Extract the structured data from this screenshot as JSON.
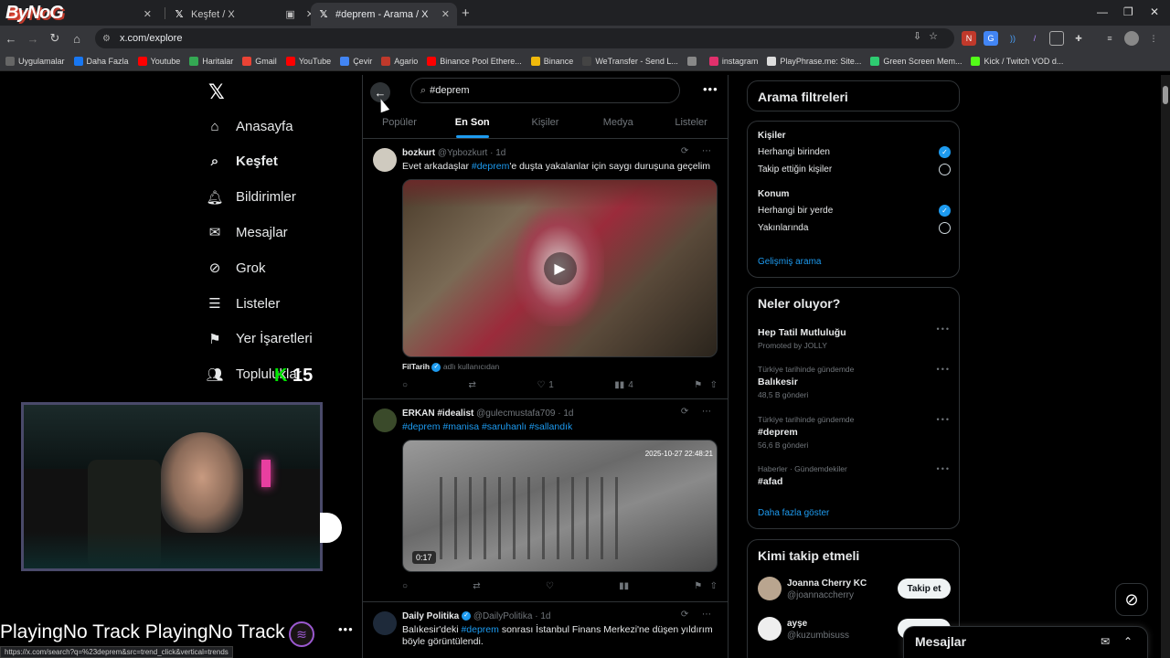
{
  "browser": {
    "tabs": [
      {
        "title": "",
        "fav": "",
        "color": "#e74c3c"
      },
      {
        "title": "Keşfet / X",
        "fav": "X",
        "color": "#000"
      },
      {
        "title": "#deprem - Arama / X",
        "fav": "X",
        "color": "#000"
      }
    ],
    "url": "x.com/explore",
    "bookmarks": [
      {
        "label": "Uygulamalar",
        "color": "#666"
      },
      {
        "label": "Daha Fazla",
        "color": "#1877f2"
      },
      {
        "label": "Youtube",
        "color": "#ff0000"
      },
      {
        "label": "Haritalar",
        "color": "#34a853"
      },
      {
        "label": "Gmail",
        "color": "#ea4335"
      },
      {
        "label": "YouTube",
        "color": "#ff0000"
      },
      {
        "label": "Çevir",
        "color": "#4285f4"
      },
      {
        "label": "Agario",
        "color": "#c0392b"
      },
      {
        "label": "Binance Pool Ethere...",
        "color": "#ff0000"
      },
      {
        "label": "Binance",
        "color": "#f0b90b"
      },
      {
        "label": "WeTransfer - Send L...",
        "color": "#444"
      },
      {
        "label": "",
        "color": "#888"
      },
      {
        "label": "instagram",
        "color": "#e1306c"
      },
      {
        "label": "PlayPhrase.me: Site...",
        "color": "#ddd"
      },
      {
        "label": "Green Screen Mem...",
        "color": "#2ecc71"
      },
      {
        "label": "Kick / Twitch VOD d...",
        "color": "#53fc18"
      }
    ],
    "status_url": "https://x.com/search?q=%23deprem&src=trend_click&vertical=trends"
  },
  "overlay": {
    "logo": "ByNoG",
    "badge_number": "15",
    "ticker": "PlayingNo Track PlayingNo Track"
  },
  "nav": {
    "items": [
      {
        "label": "Anasayfa",
        "icon": "home-icon",
        "bold": false
      },
      {
        "label": "Keşfet",
        "icon": "search-icon",
        "bold": true
      },
      {
        "label": "Bildirimler",
        "icon": "bell-icon",
        "bold": false
      },
      {
        "label": "Mesajlar",
        "icon": "envelope-icon",
        "bold": false
      },
      {
        "label": "Grok",
        "icon": "grok-icon",
        "bold": false
      },
      {
        "label": "Listeler",
        "icon": "list-icon",
        "bold": false
      },
      {
        "label": "Yer İşaretleri",
        "icon": "bookmark-icon",
        "bold": false
      },
      {
        "label": "Topluluklar",
        "icon": "communities-icon",
        "bold": false
      }
    ]
  },
  "search": {
    "query": "#deprem",
    "tabs": [
      "Popüler",
      "En Son",
      "Kişiler",
      "Medya",
      "Listeler"
    ],
    "active_tab": 1
  },
  "tweets": [
    {
      "name": "bozkurt",
      "handle": "@Ypbozkurt · 1d",
      "verified": false,
      "avatar_color": "#cfcabf",
      "text_pre": "Evet arkadaşlar ",
      "tag": "#deprem",
      "text_post": "'e duşta yakalanlar için saygı duruşuna geçelim",
      "source_name": "FilTarih",
      "source_note": "adlı kullanıcıdan",
      "replies": "",
      "reposts": "",
      "likes": "1",
      "views": "4"
    },
    {
      "name": "ERKAN #idealist",
      "handle": "@gulecmustafa709 · 1d",
      "verified": false,
      "avatar_color": "#3a4a2a",
      "tags": "#deprem #manisa #saruhanlı #sallandık",
      "video_time": "0:17",
      "cam_time": "2025-10-27 22:48:21"
    },
    {
      "name": "Daily Politika",
      "handle": "@DailyPolitika · 1d",
      "verified": true,
      "avatar_color": "#1e2a3a",
      "text_pre": "Balıkesir'deki ",
      "tag": "#deprem",
      "text_post": " sonrası İstanbul Finans Merkezi'ne düşen yıldırım böyle görüntülendi."
    }
  ],
  "filters": {
    "title": "Arama filtreleri",
    "people_label": "Kişiler",
    "people_opts": [
      "Herhangi birinden",
      "Takip ettiğin kişiler"
    ],
    "location_label": "Konum",
    "location_opts": [
      "Herhangi bir yerde",
      "Yakınlarında"
    ],
    "advanced": "Gelişmiş arama"
  },
  "trends": {
    "title": "Neler oluyor?",
    "items": [
      {
        "ctx": "",
        "name": "Hep Tatil Mutluluğu",
        "count": "Promoted by JOLLY"
      },
      {
        "ctx": "Türkiye tarihinde gündemde",
        "name": "Balıkesir",
        "count": "48,5 B gönderi"
      },
      {
        "ctx": "Türkiye tarihinde gündemde",
        "name": "#deprem",
        "count": "56,6 B gönderi"
      },
      {
        "ctx": "Haberler · Gündemdekiler",
        "name": "#afad",
        "count": ""
      }
    ],
    "more": "Daha fazla göster"
  },
  "who_to_follow": {
    "title": "Kimi takip etmeli",
    "users": [
      {
        "name": "Joanna Cherry KC",
        "handle": "@joannaccherry",
        "button": "Takip et",
        "color": "#b9a58f"
      },
      {
        "name": "ayşe",
        "handle": "@kuzumbisuss",
        "button": "",
        "color": "#eee"
      }
    ]
  },
  "messages": {
    "title": "Mesajlar"
  }
}
